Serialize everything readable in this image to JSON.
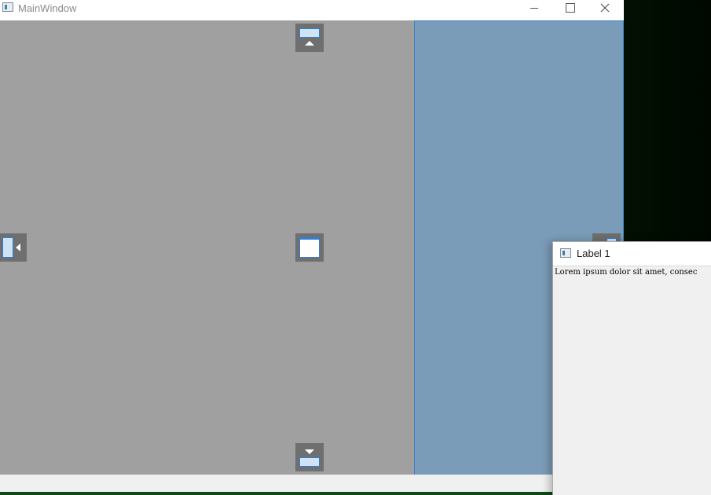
{
  "window": {
    "title": "MainWindow",
    "buttons": {
      "minimize": "—",
      "maximize": "☐",
      "close": "✕"
    }
  },
  "dock_indicators": [
    {
      "position": "top",
      "icon": "dock-top-icon"
    },
    {
      "position": "center",
      "icon": "dock-center-icon"
    },
    {
      "position": "bottom",
      "icon": "dock-bottom-icon"
    },
    {
      "position": "left",
      "icon": "dock-left-icon"
    },
    {
      "position": "right",
      "icon": "dock-right-icon"
    }
  ],
  "floating_dock": {
    "title": "Label 1",
    "content": "Lorem ipsum dolor sit amet, consec"
  },
  "colors": {
    "central_area": "#a0a0a0",
    "drop_highlight": "#7b9cb8",
    "accent": "#2f7ed8",
    "desktop": "#073007"
  }
}
